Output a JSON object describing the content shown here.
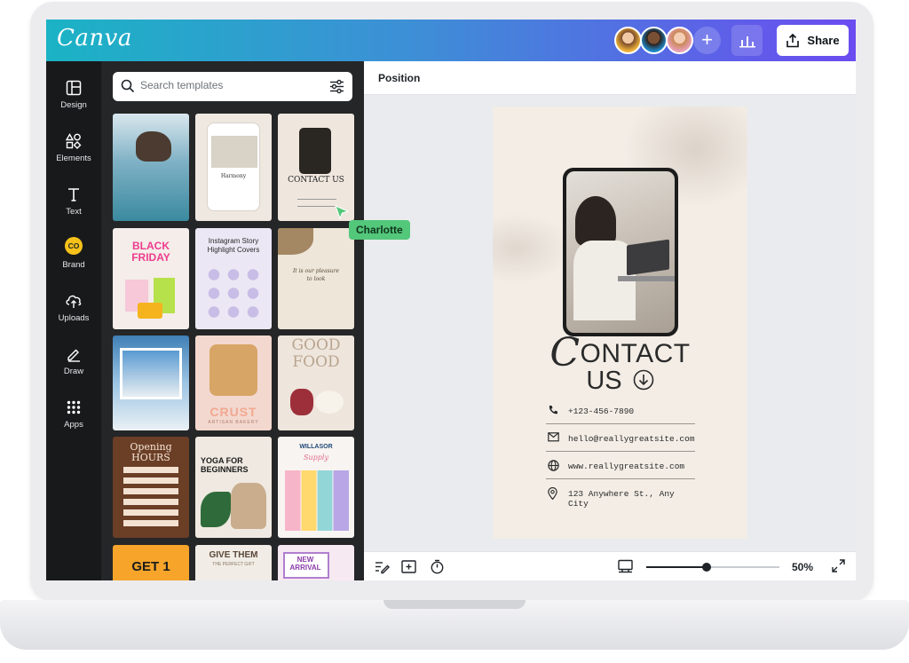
{
  "app": {
    "logo": "Canva"
  },
  "header": {
    "collaborators": [
      "collaborator-1",
      "collaborator-2",
      "collaborator-3"
    ],
    "add_icon": "plus-icon",
    "insights_icon": "bar-chart-icon",
    "share_label": "Share"
  },
  "sidebar": {
    "items": [
      {
        "label": "Design",
        "icon": "layout-icon"
      },
      {
        "label": "Elements",
        "icon": "shapes-icon"
      },
      {
        "label": "Text",
        "icon": "text-icon"
      },
      {
        "label": "Brand",
        "icon": "brand-icon",
        "badge": "CO"
      },
      {
        "label": "Uploads",
        "icon": "upload-icon"
      },
      {
        "label": "Draw",
        "icon": "pen-icon"
      },
      {
        "label": "Apps",
        "icon": "apps-icon"
      }
    ]
  },
  "templates_panel": {
    "search_placeholder": "Search templates",
    "cards": [
      {
        "title": ""
      },
      {
        "title": "Harmony"
      },
      {
        "title": "CONTACT US"
      },
      {
        "title": "BLACK FRIDAY"
      },
      {
        "title": "Instagram Story Highlight Covers"
      },
      {
        "title": "It is our pleasure to look"
      },
      {
        "title": ""
      },
      {
        "title": "CRUST",
        "subtitle": "ARTISAN BAKERY"
      },
      {
        "title": "GOOD FOOD"
      },
      {
        "title": "Opening HOURS"
      },
      {
        "title": "YOGA FOR BEGINNERS"
      },
      {
        "title": "WILLASOR",
        "subtitle": "Supply"
      },
      {
        "title": "GET 1"
      },
      {
        "title": "GIVE THEM",
        "subtitle": "THE PERFECT GIFT"
      },
      {
        "title": "NEW ARRIVAL"
      }
    ]
  },
  "collaborator_cursor": {
    "name": "Charlotte",
    "color": "#53c77a"
  },
  "editor": {
    "toolbar_label": "Position",
    "design": {
      "title_first": "C",
      "title_rest": "ONTACT",
      "title_line2": "US",
      "phone": "+123-456-7890",
      "email": "hello@reallygreatsite.com",
      "website": "www.reallygreatsite.com",
      "address": "123 Anywhere St., Any City"
    },
    "zoom": "50%",
    "zoom_fraction": 0.45
  },
  "colors": {
    "header_gradient_start": "#1bb3c5",
    "header_gradient_end": "#6b4cf0",
    "sidebar_bg": "#18191b",
    "panel_bg": "#252627",
    "page_bg": "#f3ede6"
  }
}
